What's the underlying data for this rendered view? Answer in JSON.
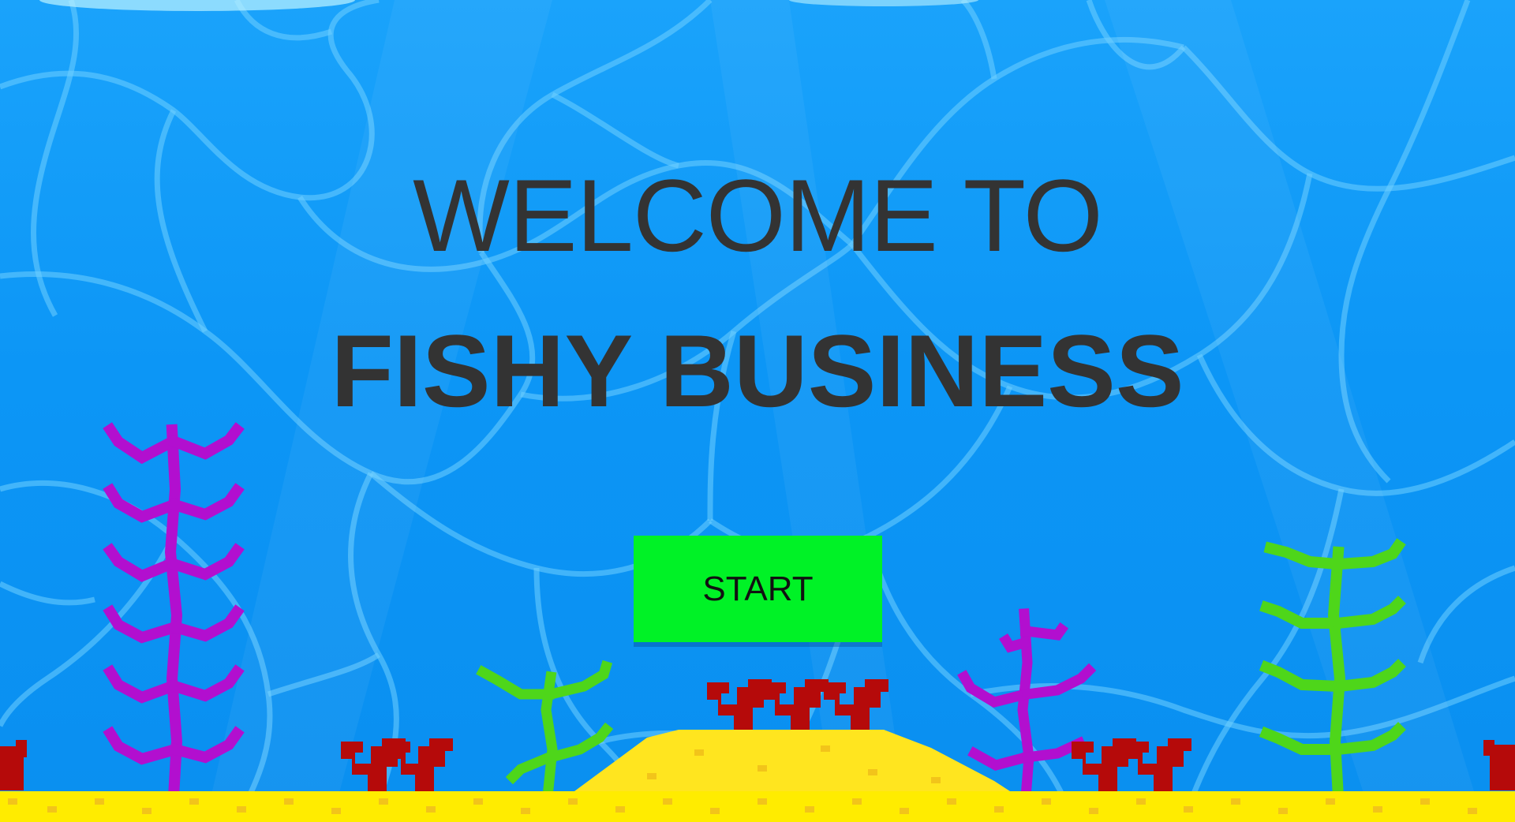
{
  "title": {
    "line1": "WELCOME TO",
    "line2": "FISHY BUSINESS"
  },
  "start_button": {
    "label": "START"
  },
  "colors": {
    "water": "#0c96f6",
    "caustic_lines": "#6fd0ff",
    "title_text": "#333333",
    "start_button": "#00f226",
    "sand": "#ffe51f",
    "purple_seaweed": "#b20fcf",
    "green_seaweed": "#4ed61a",
    "red_coral": "#b50a0a"
  }
}
